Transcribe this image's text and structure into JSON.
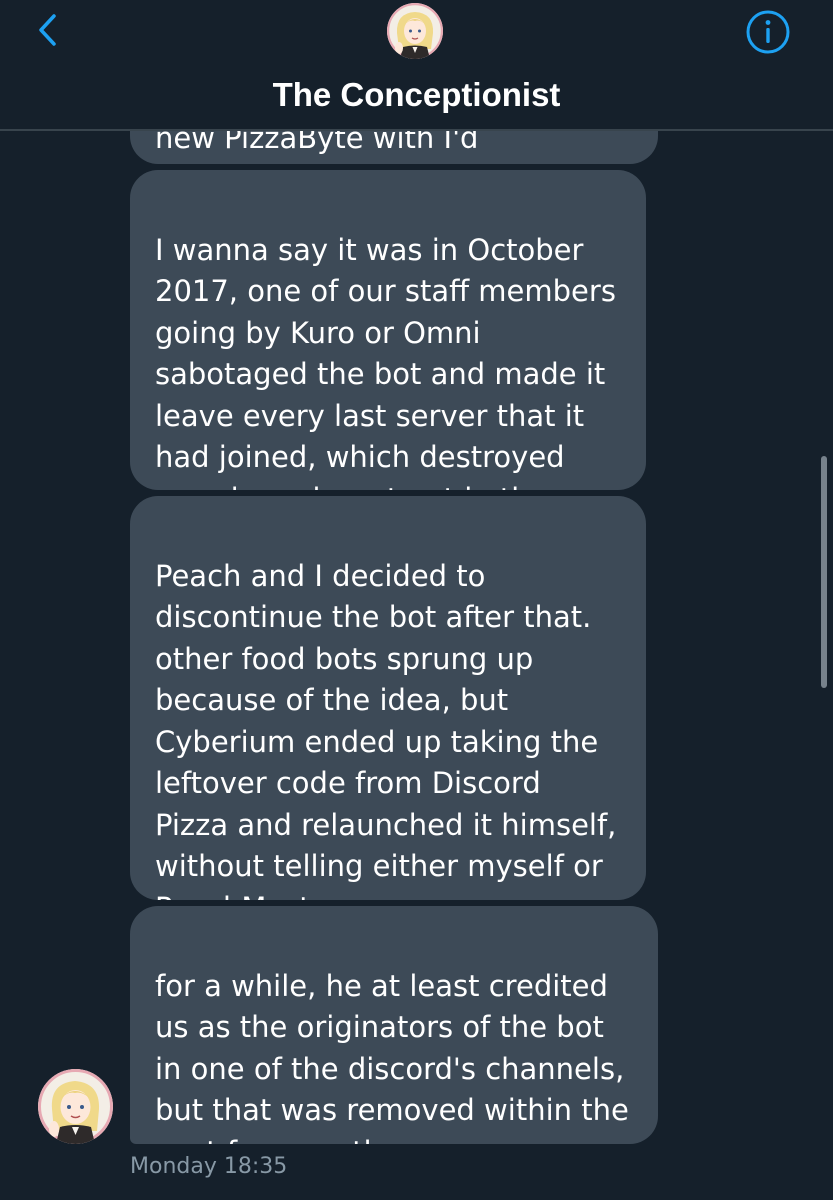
{
  "header": {
    "title": "The Conceptionist",
    "back_icon": "chevron-left-icon",
    "info_icon": "info-circle-icon",
    "accent_color": "#1da1f2"
  },
  "conversation": {
    "messages": [
      {
        "text": "new PizzaByte with I'd"
      },
      {
        "text": "I wanna say it was in October\n2017, one of our staff members\ngoing by Kuro or Omni\nsabotaged the bot and made it\nleave every last server that it\nhad joined, which destroyed\nmorale and our trust in the team"
      },
      {
        "text": "Peach and I decided to\ndiscontinue the bot after that.\nother food bots sprung up\nbecause of the idea, but\nCyberium ended up taking the\nleftover code from Discord\nPizza and relaunched it himself,\nwithout telling either myself or\nPeachMaster"
      },
      {
        "text": "for a while, he at least credited\nus as the originators of the bot\nin one of the discord's channels,\nbut that was removed within the\npast few months"
      }
    ],
    "timestamp": "Monday 18:35"
  },
  "colors": {
    "background": "#15202b",
    "bubble": "#3d4a57",
    "timestamp": "#8899a6",
    "divider": "#38444d"
  }
}
